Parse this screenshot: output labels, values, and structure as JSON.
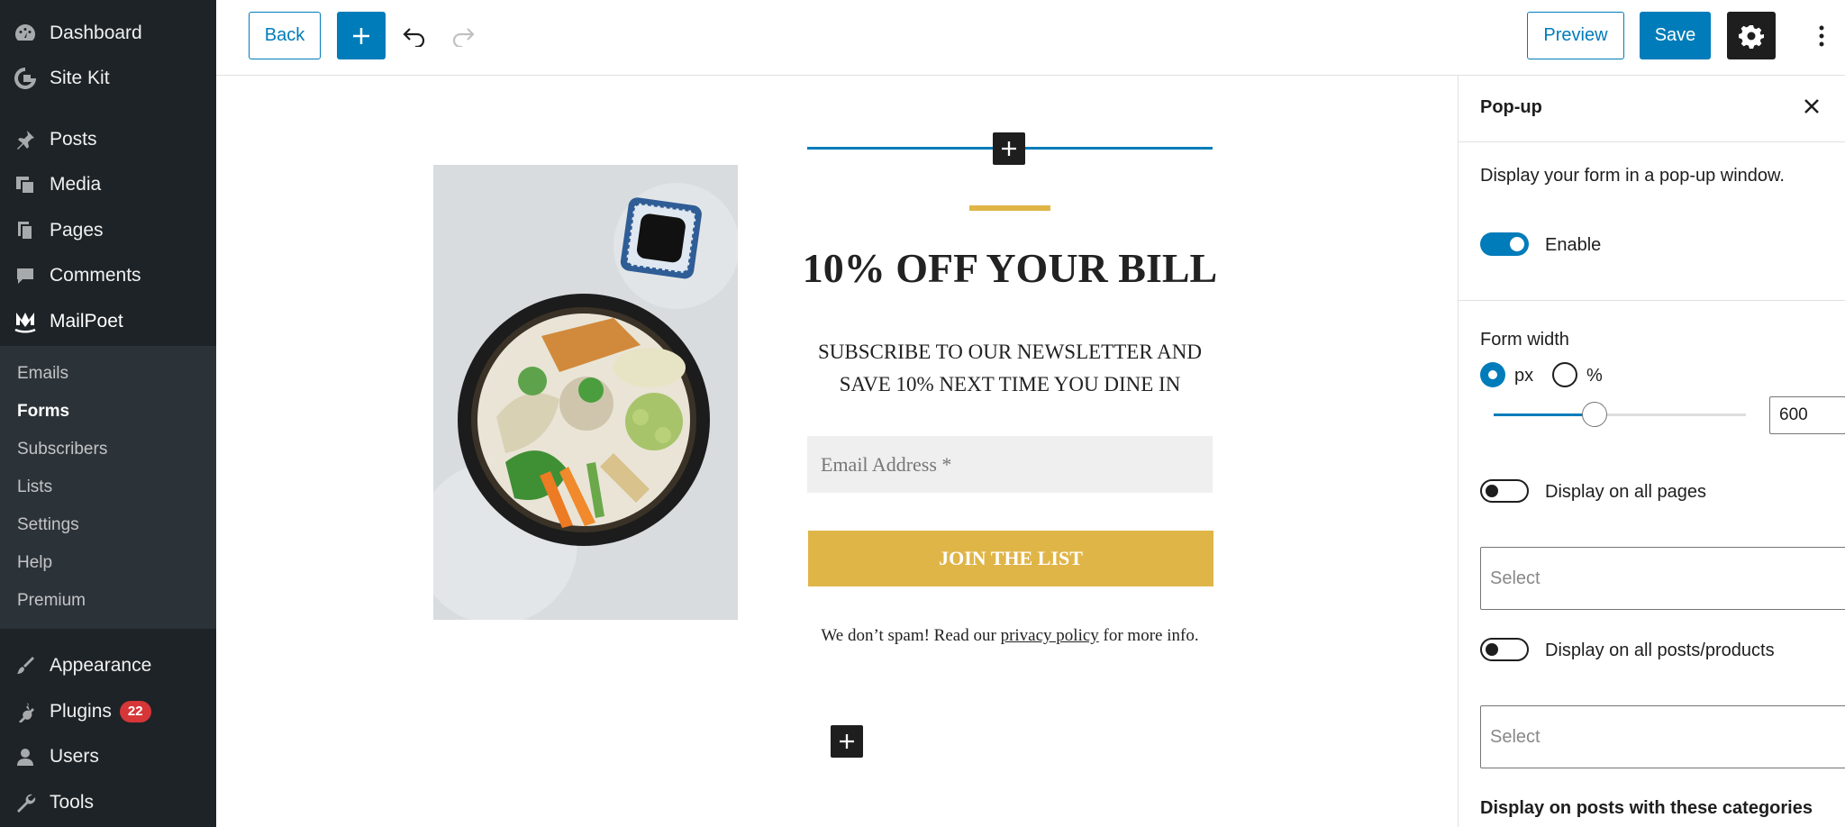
{
  "sidebar": {
    "items": [
      {
        "label": "Dashboard",
        "icon": "dashboard-icon"
      },
      {
        "label": "Site Kit",
        "icon": "google-g-icon"
      },
      {
        "label": "Posts",
        "icon": "pin-icon"
      },
      {
        "label": "Media",
        "icon": "media-icon"
      },
      {
        "label": "Pages",
        "icon": "pages-icon"
      },
      {
        "label": "Comments",
        "icon": "comment-icon"
      },
      {
        "label": "MailPoet",
        "icon": "mailpoet-icon"
      },
      {
        "label": "Appearance",
        "icon": "brush-icon"
      },
      {
        "label": "Plugins",
        "icon": "plugin-icon",
        "badge": "22"
      },
      {
        "label": "Users",
        "icon": "user-icon"
      },
      {
        "label": "Tools",
        "icon": "wrench-icon"
      }
    ],
    "submenu": [
      "Emails",
      "Forms",
      "Subscribers",
      "Lists",
      "Settings",
      "Help",
      "Premium"
    ],
    "active_submenu": "Forms"
  },
  "toolbar": {
    "back_label": "Back",
    "preview_label": "Preview",
    "save_label": "Save"
  },
  "form": {
    "headline": "10% OFF YOUR BILL",
    "subtext": "SUBSCRIBE TO OUR NEWSLETTER AND SAVE 10% NEXT TIME YOU DINE IN",
    "email_placeholder": "Email Address *",
    "button_label": "JOIN THE LIST",
    "spam_prefix": "We don’t spam! Read our ",
    "spam_link": "privacy policy",
    "spam_suffix": " for more info."
  },
  "panel": {
    "title": "Pop-up",
    "description": "Display your form in a pop-up window.",
    "enable_label": "Enable",
    "enable_on": true,
    "form_width_label": "Form width",
    "unit_px": "px",
    "unit_percent": "%",
    "selected_unit": "px",
    "width_value": "600",
    "slider_fraction": 0.4,
    "display_all_pages_label": "Display on all pages",
    "display_all_pages_on": false,
    "select_placeholder_1": "Select",
    "display_all_posts_label": "Display on all posts/products",
    "display_all_posts_on": false,
    "select_placeholder_2": "Select",
    "categories_heading": "Display on posts with these categories"
  },
  "colors": {
    "accent": "#007cba",
    "gold": "#e0b548",
    "sidebar_bg": "#1d2327",
    "badge": "#d63638"
  }
}
